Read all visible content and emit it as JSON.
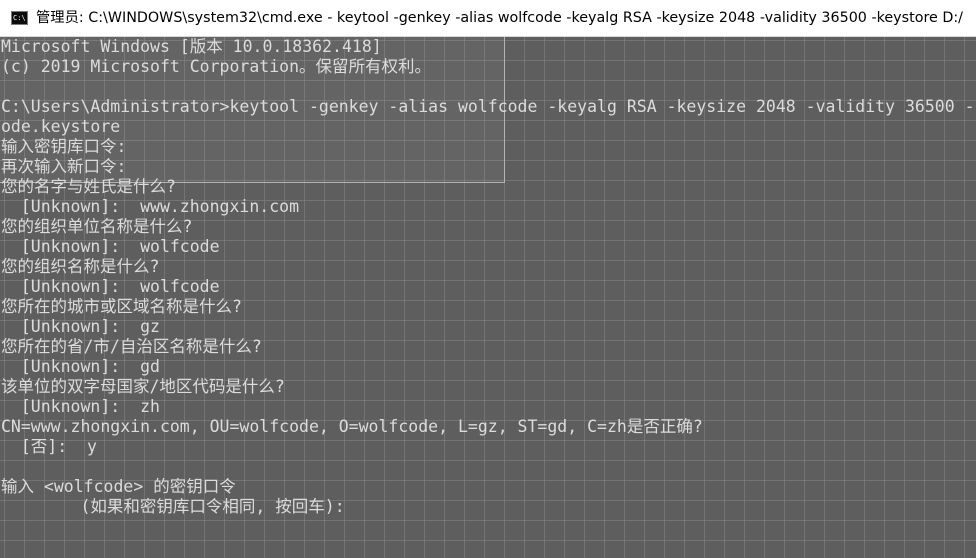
{
  "window": {
    "title": "管理员: C:\\WINDOWS\\system32\\cmd.exe - keytool  -genkey -alias wolfcode -keyalg RSA -keysize 2048 -validity 36500 -keystore D:/",
    "icon": "C:\\."
  },
  "console": {
    "lines": [
      "Microsoft Windows [版本 10.0.18362.418]",
      "(c) 2019 Microsoft Corporation。保留所有权利。",
      "",
      "C:\\Users\\Administrator>keytool -genkey -alias wolfcode -keyalg RSA -keysize 2048 -validity 36500 -",
      "ode.keystore",
      "输入密钥库口令:",
      "再次输入新口令:",
      "您的名字与姓氏是什么?",
      "  [Unknown]:  www.zhongxin.com",
      "您的组织单位名称是什么?",
      "  [Unknown]:  wolfcode",
      "您的组织名称是什么?",
      "  [Unknown]:  wolfcode",
      "您所在的城市或区域名称是什么?",
      "  [Unknown]:  gz",
      "您所在的省/市/自治区名称是什么?",
      "  [Unknown]:  gd",
      "该单位的双字母国家/地区代码是什么?",
      "  [Unknown]:  zh",
      "CN=www.zhongxin.com, OU=wolfcode, O=wolfcode, L=gz, ST=gd, C=zh是否正确?",
      "  [否]:  y",
      "",
      "输入 <wolfcode> 的密钥口令",
      "        (如果和密钥库口令相同, 按回车):"
    ]
  }
}
